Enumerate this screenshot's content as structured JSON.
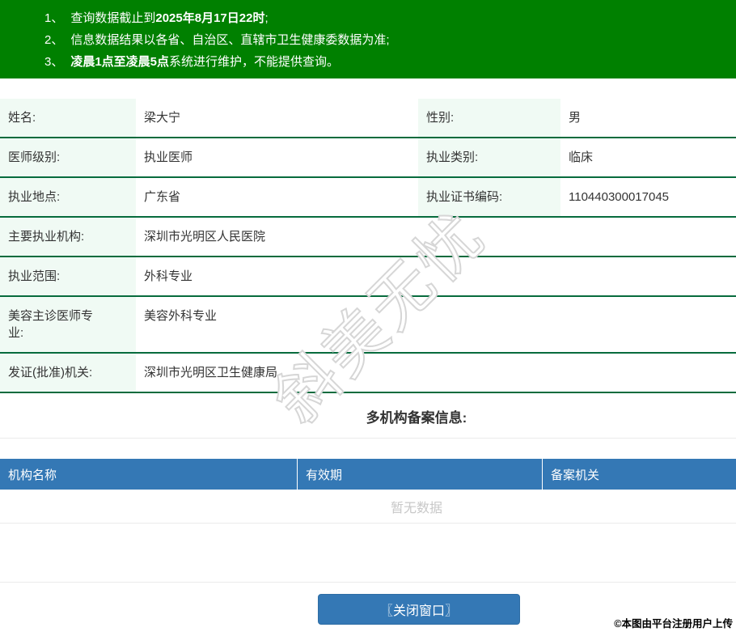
{
  "banner": {
    "bg_color": "#008000",
    "lines": [
      {
        "num": "1、",
        "pre": "查询数据截止到",
        "bold": "2025年8月17日22时",
        "post": ";"
      },
      {
        "num": "2、",
        "pre": "信息数据结果以各省、自治区、直辖市卫生健康委数据为准;",
        "bold": "",
        "post": ""
      },
      {
        "num": "3、",
        "pre": "",
        "bold": "凌晨1点至凌晨5点",
        "post": "系统进行维护，不能提供查询。"
      }
    ]
  },
  "profile": {
    "label_bg_color": "#f0faf4",
    "divider_color": "#076b3d",
    "rows": [
      {
        "cells": [
          {
            "label": "姓名:",
            "value": "梁大宁"
          },
          {
            "label": "性别:",
            "value": "男"
          }
        ]
      },
      {
        "cells": [
          {
            "label": "医师级别:",
            "value": "执业医师"
          },
          {
            "label": "执业类别:",
            "value": "临床"
          }
        ]
      },
      {
        "cells": [
          {
            "label": "执业地点:",
            "value": "广东省"
          },
          {
            "label": "执业证书编码:",
            "value": "110440300017045"
          }
        ]
      },
      {
        "cells": [
          {
            "label": "主要执业机构:",
            "value": "深圳市光明区人民医院"
          }
        ]
      },
      {
        "cells": [
          {
            "label": "执业范围:",
            "value": "外科专业"
          }
        ]
      },
      {
        "cells": [
          {
            "label": "美容主诊医师专业:",
            "value": "美容外科专业"
          }
        ]
      },
      {
        "cells": [
          {
            "label": "发证(批准)机关:",
            "value": "深圳市光明区卫生健康局"
          }
        ]
      }
    ]
  },
  "registration": {
    "heading": "多机构备案信息:",
    "header_bg_color": "#3478b5",
    "columns": [
      "机构名称",
      "有效期",
      "备案机关"
    ],
    "empty_text": "暂无数据"
  },
  "footer": {
    "close_button": "〖关闭窗口〗",
    "button_color": "#3478b5",
    "credit": "©本图由平台注册用户上传"
  },
  "watermark": "斜美无忧"
}
